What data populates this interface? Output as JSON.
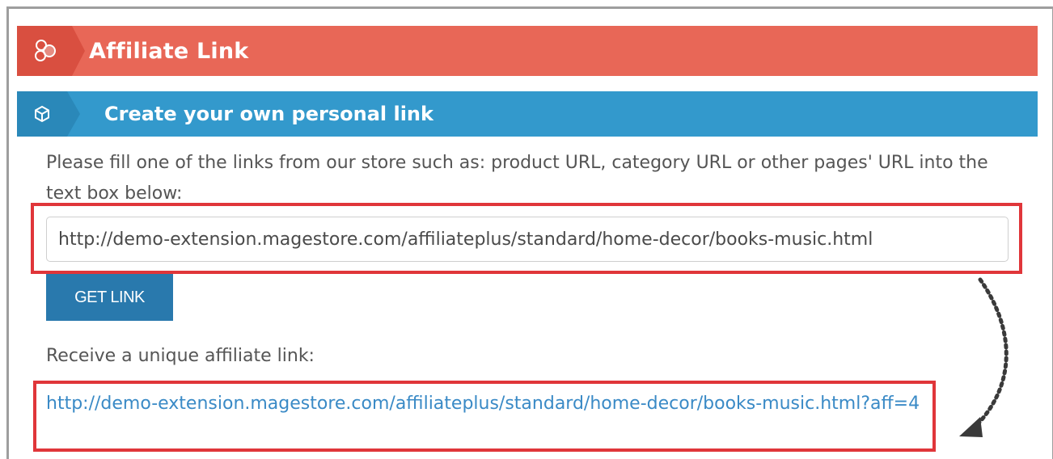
{
  "colors": {
    "header_red": "#e86757",
    "header_blue": "#3399cc",
    "highlight_red": "#e0363a",
    "button_blue": "#2979ad",
    "link_blue": "#3a8ac6"
  },
  "affiliate_header": {
    "icon": "affiliate-circles-icon",
    "title": "Affiliate Link"
  },
  "create_link_section": {
    "icon": "cube-icon",
    "title": "Create your own personal link",
    "instructions": "Please fill one of the links from our store such as: product URL, category URL or other pages' URL into the text box below:",
    "url_input_value": "http://demo-extension.magestore.com/affiliateplus/standard/home-decor/books-music.html",
    "get_link_label": "GET LINK",
    "receive_label": "Receive a unique affiliate link:",
    "affiliate_link": "http://demo-extension.magestore.com/affiliateplus/standard/home-decor/books-music.html?aff=4"
  },
  "annotation": {
    "arrow_icon": "dotted-curved-arrow-icon"
  }
}
